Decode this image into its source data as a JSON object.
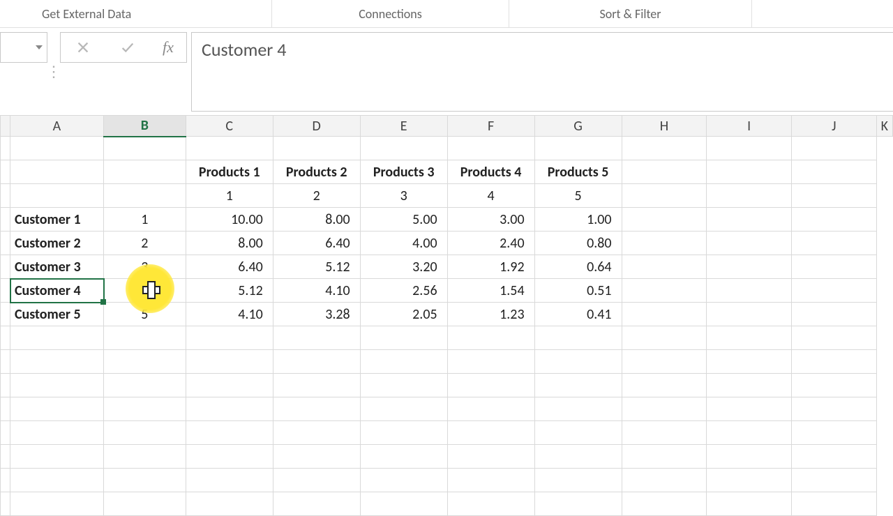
{
  "ribbon": {
    "group_left": "Get External Data",
    "group_mid": "Connections",
    "group_right": "Sort & Filter"
  },
  "formula_bar": {
    "fx_label": "fx",
    "value": "Customer 4"
  },
  "columns": [
    "A",
    "B",
    "C",
    "D",
    "E",
    "F",
    "G",
    "H",
    "I",
    "J",
    "K"
  ],
  "selected_column": "B",
  "headers": {
    "products": [
      "Products 1",
      "Products 2",
      "Products 3",
      "Products 4",
      "Products 5"
    ],
    "product_nums": [
      "1",
      "2",
      "3",
      "4",
      "5"
    ]
  },
  "rows": [
    {
      "label": "Customer 1",
      "index": "1",
      "vals": [
        "10.00",
        "8.00",
        "5.00",
        "3.00",
        "1.00"
      ]
    },
    {
      "label": "Customer 2",
      "index": "2",
      "vals": [
        "8.00",
        "6.40",
        "4.00",
        "2.40",
        "0.80"
      ]
    },
    {
      "label": "Customer 3",
      "index": "3",
      "vals": [
        "6.40",
        "5.12",
        "3.20",
        "1.92",
        "0.64"
      ]
    },
    {
      "label": "Customer 4",
      "index": "4",
      "vals": [
        "5.12",
        "4.10",
        "2.56",
        "1.54",
        "0.51"
      ]
    },
    {
      "label": "Customer 5",
      "index": "5",
      "vals": [
        "4.10",
        "3.28",
        "2.05",
        "1.23",
        "0.41"
      ]
    }
  ],
  "active_cell": "B7"
}
